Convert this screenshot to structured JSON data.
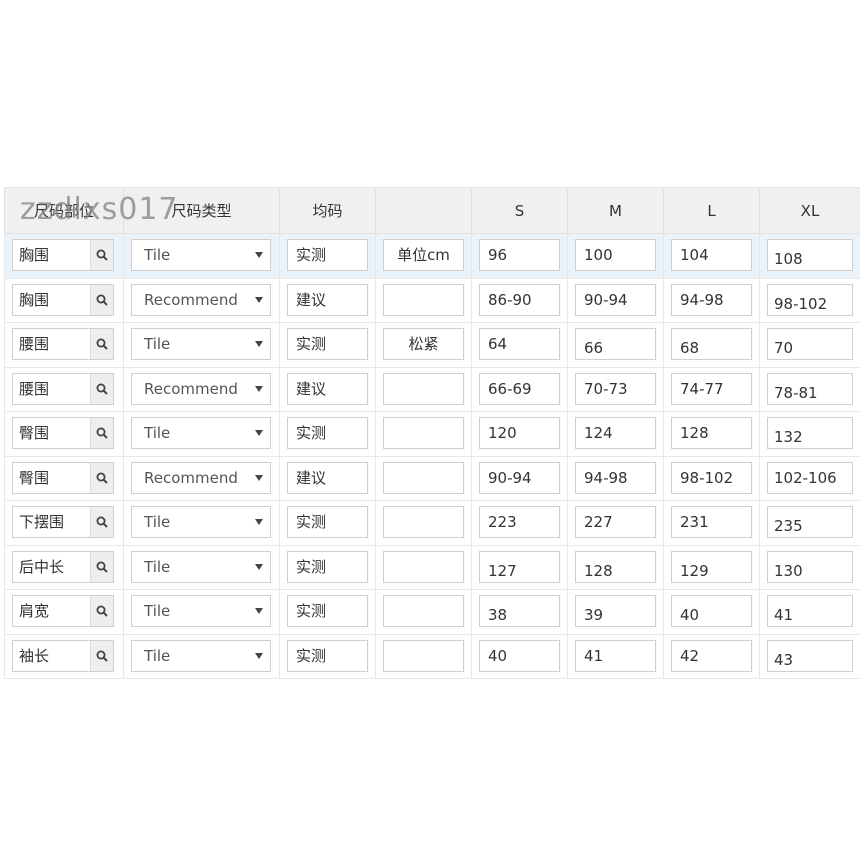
{
  "watermark": "zzdlxs017",
  "headers": {
    "part": "尺码部位",
    "type": "尺码类型",
    "one_size": "均码",
    "unit": "",
    "sizes": [
      "S",
      "M",
      "L",
      "XL"
    ]
  },
  "rows": [
    {
      "part": "胸围",
      "type": "Tile",
      "one_size": "实测",
      "unit": "单位cm",
      "values": [
        "96",
        "100",
        "104",
        "108"
      ]
    },
    {
      "part": "胸围",
      "type": "Recommend",
      "one_size": "建议",
      "unit": "",
      "values": [
        "86-90",
        "90-94",
        "94-98",
        "98-102"
      ]
    },
    {
      "part": "腰围",
      "type": "Tile",
      "one_size": "实测",
      "unit": "松紧",
      "values": [
        "64",
        "66",
        "68",
        "70"
      ]
    },
    {
      "part": "腰围",
      "type": "Recommend",
      "one_size": "建议",
      "unit": "",
      "values": [
        "66-69",
        "70-73",
        "74-77",
        "78-81"
      ]
    },
    {
      "part": "臀围",
      "type": "Tile",
      "one_size": "实测",
      "unit": "",
      "values": [
        "120",
        "124",
        "128",
        "132"
      ]
    },
    {
      "part": "臀围",
      "type": "Recommend",
      "one_size": "建议",
      "unit": "",
      "values": [
        "90-94",
        "94-98",
        "98-102",
        "102-106"
      ]
    },
    {
      "part": "下摆围",
      "type": "Tile",
      "one_size": "实测",
      "unit": "",
      "values": [
        "223",
        "227",
        "231",
        "235"
      ]
    },
    {
      "part": "后中长",
      "type": "Tile",
      "one_size": "实测",
      "unit": "",
      "values": [
        "127",
        "128",
        "129",
        "130"
      ]
    },
    {
      "part": "肩宽",
      "type": "Tile",
      "one_size": "实测",
      "unit": "",
      "values": [
        "38",
        "39",
        "40",
        "41"
      ]
    },
    {
      "part": "袖长",
      "type": "Tile",
      "one_size": "实测",
      "unit": "",
      "values": [
        "40",
        "41",
        "42",
        "43"
      ]
    }
  ],
  "icons": {
    "search": "search-icon",
    "dropdown": "dropdown-arrow-icon"
  },
  "colors": {
    "header_bg": "#f0f0f0",
    "first_row_bg": "#eaf2fa",
    "border": "#cfcfcf"
  }
}
